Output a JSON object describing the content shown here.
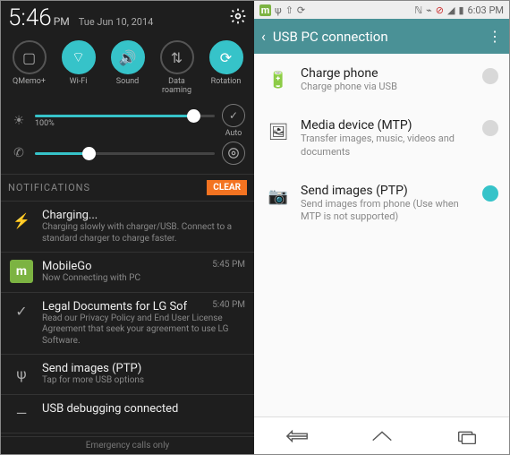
{
  "left": {
    "status": {
      "time": "5:46",
      "ampm": "PM",
      "date": "Tue Jun 10, 2014"
    },
    "toggles": [
      {
        "label": "QMemo+",
        "on": false,
        "icon": "▢"
      },
      {
        "label": "Wi-Fi",
        "on": true,
        "icon": "⌔"
      },
      {
        "label": "Sound",
        "on": true,
        "icon": "🔊"
      },
      {
        "label": "Data roaming",
        "on": false,
        "icon": "⇅"
      },
      {
        "label": "Rotation",
        "on": true,
        "icon": "⟳"
      }
    ],
    "brightness": {
      "pct_label": "100%",
      "fill": 88,
      "auto_label": "Auto"
    },
    "volume": {
      "fill": 30
    },
    "notif_header": "NOTIFICATIONS",
    "clear_label": "CLEAR",
    "notifications": [
      {
        "icon": "⚡",
        "title": "Charging...",
        "text": "Charging slowly with charger/USB. Connect to a standard charger to charge faster.",
        "time": ""
      },
      {
        "icon": "m",
        "title": "MobileGo",
        "text": "Now Connecting with PC",
        "time": "5:45 PM",
        "mgo": true
      },
      {
        "icon": "✓",
        "title": "Legal Documents for LG Sof",
        "text": "Read our Privacy Policy and End User License Agreement that seek your agreement to use LG Software.",
        "time": "5:40 PM"
      },
      {
        "icon": "ψ",
        "title": "Send images (PTP)",
        "text": "Tap for more USB options",
        "time": ""
      },
      {
        "icon": "—",
        "title": "USB debugging connected",
        "text": "",
        "time": ""
      }
    ],
    "footer": "Emergency calls only"
  },
  "right": {
    "status_time": "6:03 PM",
    "header": {
      "title": "USB PC connection"
    },
    "options": [
      {
        "icon": "🔋",
        "title": "Charge phone",
        "text": "Charge phone via USB",
        "selected": false
      },
      {
        "icon": "🖼",
        "title": "Media device (MTP)",
        "text": "Transfer images, music, videos and documents",
        "selected": false
      },
      {
        "icon": "📷",
        "title": "Send images (PTP)",
        "text": "Send images from phone (Use when MTP is not supported)",
        "selected": true
      }
    ]
  }
}
